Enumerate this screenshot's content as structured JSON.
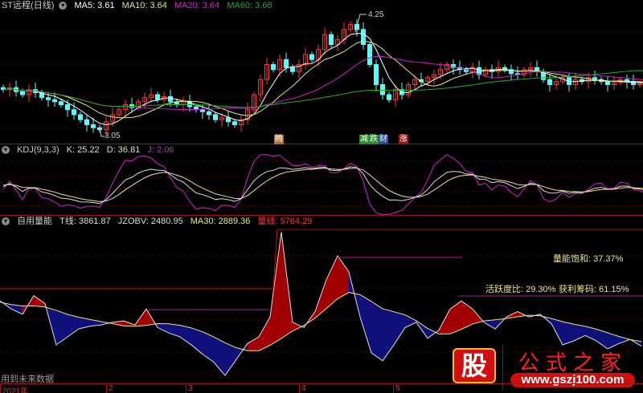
{
  "main": {
    "title": "ST远程(日线)",
    "ma5": "MA5: 3.61",
    "ma10": "MA10: 3.64",
    "ma20": "MA20: 3.64",
    "ma60": "MA60: 3.68",
    "high_label": "4.25",
    "low_label": "3.05",
    "tags": [
      {
        "text": "腾",
        "color": "#b07030"
      },
      {
        "text": "减",
        "color": "#2a8a2a"
      },
      {
        "text": "跌",
        "color": "#2a8a2a"
      },
      {
        "text": "财",
        "color": "#2a4a9a"
      },
      {
        "text": "涨",
        "color": "#a01010"
      }
    ],
    "closes": [
      3.5,
      3.52,
      3.48,
      3.45,
      3.5,
      3.47,
      3.42,
      3.4,
      3.38,
      3.35,
      3.3,
      3.25,
      3.2,
      3.15,
      3.12,
      3.1,
      3.18,
      3.25,
      3.3,
      3.35,
      3.32,
      3.38,
      3.42,
      3.45,
      3.4,
      3.43,
      3.38,
      3.35,
      3.38,
      3.33,
      3.3,
      3.28,
      3.25,
      3.2,
      3.22,
      3.18,
      3.15,
      3.2,
      3.3,
      3.45,
      3.6,
      3.75,
      3.7,
      3.8,
      3.72,
      3.68,
      3.75,
      3.85,
      3.8,
      3.9,
      4.05,
      3.95,
      4.0,
      4.1,
      4.15,
      4.1,
      3.95,
      3.75,
      3.55,
      3.45,
      3.4,
      3.5,
      3.45,
      3.55,
      3.6,
      3.58,
      3.62,
      3.65,
      3.7,
      3.75,
      3.72,
      3.7,
      3.68,
      3.72,
      3.65,
      3.7,
      3.68,
      3.72,
      3.7,
      3.66,
      3.65,
      3.7,
      3.72,
      3.68,
      3.6,
      3.55,
      3.58,
      3.62,
      3.55,
      3.6,
      3.58,
      3.62,
      3.6,
      3.58,
      3.55,
      3.57,
      3.6,
      3.58,
      3.55,
      3.56,
      3.54
    ]
  },
  "kdj": {
    "title": "KDJ(9,3,3)",
    "k": "K: 25.22",
    "d": "D: 36.81",
    "j": "J: 2.06"
  },
  "vol": {
    "title": "自用量能",
    "t": "T线: 3861.87",
    "jzobv": "JZOBV: 2480.95",
    "ma30": "MA30: 2889.36",
    "top": "量线: 5764.29",
    "saturation": "量能饱和:  37.37%",
    "activity": "活跃度比:  29.30%",
    "profit": "获利筹码:  61.15%",
    "note": "用到未来数据",
    "t_values": [
      3108,
      2800,
      2600,
      3300,
      3000,
      1449,
      1750,
      2052,
      2150,
      2200,
      2300,
      2350,
      2200,
      2800,
      2100,
      1900,
      1750,
      1450,
      1100,
      800,
      300,
      900,
      1500,
      1750,
      2500,
      5700,
      2300,
      2100,
      2700,
      3900,
      4800,
      4200,
      2500,
      1150,
      850,
      1450,
      2100,
      2300,
      1700,
      2000,
      2800,
      3100,
      2800,
      2300,
      2050,
      2500,
      2700,
      2500,
      2600,
      2250,
      1450,
      1600,
      1800,
      1600,
      1300,
      1500,
      1650,
      1400
    ],
    "max": 5764.29
  },
  "axis": [
    "2021年",
    "2",
    "3",
    "4",
    "5"
  ],
  "watermark": {
    "char": "股",
    "name": "公式之家",
    "url": "www.gszj100.com"
  },
  "colors": {
    "up": "#ff3232",
    "down": "#54fcfc",
    "ma5": "#ffffff",
    "ma10": "#e6e68a",
    "ma20": "#d020d0",
    "ma60": "#20b020"
  }
}
